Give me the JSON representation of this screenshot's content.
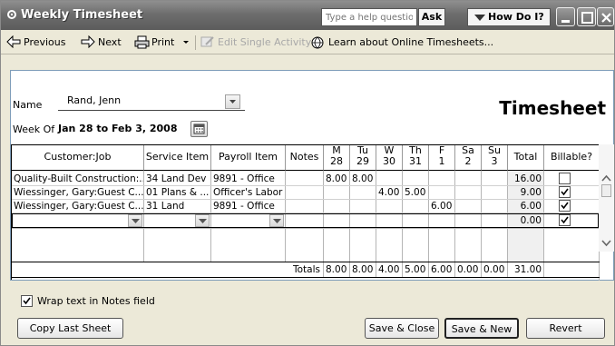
{
  "window": {
    "title": "Weekly Timesheet"
  },
  "help": {
    "placeholder": "Type a help question",
    "ask_label": "Ask",
    "how_do_i_label": "How Do I?"
  },
  "toolbar": {
    "previous_label": "Previous",
    "next_label": "Next",
    "print_label": "Print",
    "edit_single_activity_label": "Edit Single Activity",
    "learn_label": "Learn about Online Timesheets..."
  },
  "header": {
    "name_label": "Name",
    "name_value": "Rand, Jenn",
    "week_of_label": "Week Of",
    "week_of_value": "Jan 28 to Feb 3, 2008",
    "title": "Timesheet"
  },
  "table": {
    "columns": [
      {
        "line1": "Customer:Job",
        "line2": ""
      },
      {
        "line1": "Service Item",
        "line2": ""
      },
      {
        "line1": "Payroll Item",
        "line2": ""
      },
      {
        "line1": "Notes",
        "line2": ""
      },
      {
        "line1": "M",
        "line2": "28"
      },
      {
        "line1": "Tu",
        "line2": "29"
      },
      {
        "line1": "W",
        "line2": "30"
      },
      {
        "line1": "Th",
        "line2": "31"
      },
      {
        "line1": "F",
        "line2": "1"
      },
      {
        "line1": "Sa",
        "line2": "2"
      },
      {
        "line1": "Su",
        "line2": "3"
      },
      {
        "line1": "Total",
        "line2": ""
      },
      {
        "line1": "Billable?",
        "line2": ""
      }
    ],
    "rows": [
      {
        "customer_job": "Quality-Built Construction:...",
        "service_item": "34 Land Dev",
        "payroll_item": "9891 - Office",
        "notes": "",
        "m": "8.00",
        "tu": "8.00",
        "w": "",
        "th": "",
        "f": "",
        "sa": "",
        "su": "",
        "total": "16.00",
        "billable": false
      },
      {
        "customer_job": "Wiessinger, Gary:Guest C...",
        "service_item": "01 Plans & ...",
        "payroll_item": "Officer's Labor",
        "notes": "",
        "m": "",
        "tu": "",
        "w": "4.00",
        "th": "5.00",
        "f": "",
        "sa": "",
        "su": "",
        "total": "9.00",
        "billable": true
      },
      {
        "customer_job": "Wiessinger, Gary:Guest C...",
        "service_item": "31 Land",
        "payroll_item": "9891 - Office",
        "notes": "",
        "m": "",
        "tu": "",
        "w": "",
        "th": "",
        "f": "6.00",
        "sa": "",
        "su": "",
        "total": "6.00",
        "billable": true
      },
      {
        "customer_job": "",
        "service_item": "",
        "payroll_item": "",
        "notes": "",
        "m": "",
        "tu": "",
        "w": "",
        "th": "",
        "f": "",
        "sa": "",
        "su": "",
        "total": "0.00",
        "billable": true
      }
    ],
    "totals": {
      "label": "Totals",
      "m": "8.00",
      "tu": "8.00",
      "w": "4.00",
      "th": "5.00",
      "f": "6.00",
      "sa": "0.00",
      "su": "0.00",
      "total": "31.00"
    }
  },
  "footer": {
    "wrap_label": "Wrap text in Notes field",
    "wrap_checked": true,
    "copy_last_sheet_label": "Copy Last Sheet",
    "save_close_label": "Save & Close",
    "save_new_label": "Save & New",
    "revert_label": "Revert"
  }
}
